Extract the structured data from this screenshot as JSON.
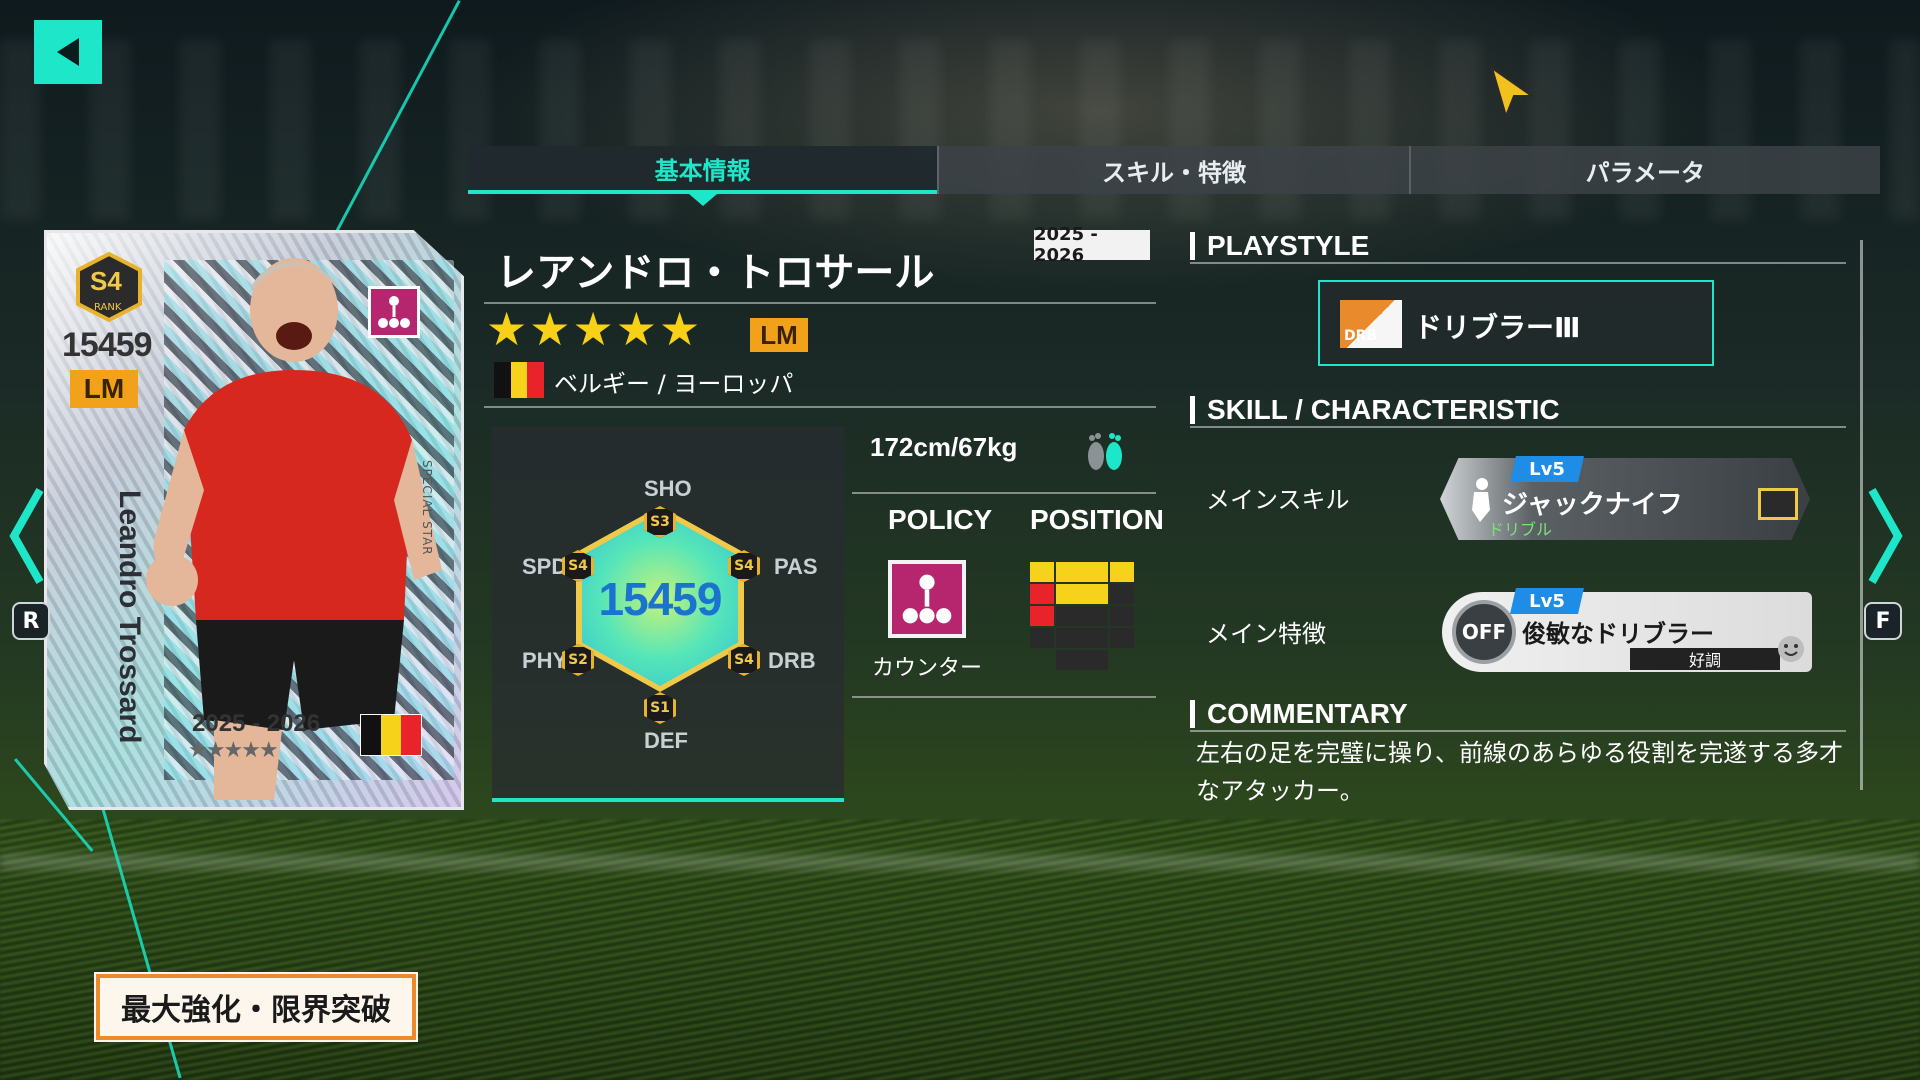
{
  "tabs": [
    {
      "label": "基本情報",
      "active": true
    },
    {
      "label": "スキル・特徴",
      "active": false
    },
    {
      "label": "パラメータ",
      "active": false
    }
  ],
  "card": {
    "rank": "S4",
    "rank_sub": "RANK",
    "rating": "15459",
    "position": "LM",
    "name": "Leandro Trossard",
    "tag": "SPECIAL STAR",
    "season": "2025 - 2026",
    "stars": "★★★★★"
  },
  "player": {
    "name": "レアンドロ・トロサール",
    "season": "2025 - 2026",
    "stars": "★★★★★",
    "position": "LM",
    "nation": "ベルギー / ヨーロッパ",
    "flag_colors": [
      "#111111",
      "#f6d21a",
      "#e8232a"
    ]
  },
  "stats": {
    "overall": "15459",
    "SHO": {
      "label": "SHO",
      "rank": "S3"
    },
    "PAS": {
      "label": "PAS",
      "rank": "S4"
    },
    "DRB": {
      "label": "DRB",
      "rank": "S4"
    },
    "DEF": {
      "label": "DEF",
      "rank": "S1"
    },
    "PHY": {
      "label": "PHY",
      "rank": "S2"
    },
    "SPD": {
      "label": "SPD",
      "rank": "S4"
    }
  },
  "body": "172cm/67kg",
  "policy": {
    "header": "POLICY",
    "value": "カウンター"
  },
  "position_header": "POSITION",
  "sections": {
    "playstyle": "PLAYSTYLE",
    "skill": "SKILL / CHARACTERISTIC",
    "commentary": "COMMENTARY"
  },
  "playstyle": {
    "tag": "DRB",
    "name": "ドリブラーⅢ"
  },
  "main_skill": {
    "label": "メインスキル",
    "level": "Lv5",
    "name": "ジャックナイフ",
    "tag": "ドリブル"
  },
  "main_trait": {
    "label": "メイン特徴",
    "level": "Lv5",
    "name": "俊敏なドリブラー",
    "state": "OFF",
    "condition": "好調"
  },
  "commentary_text": "左右の足を完璧に操り、前線のあらゆる役割を完遂する多才なアタッカー。",
  "enhance_button": "最大強化・限界突破",
  "nav": {
    "left_key": "R",
    "right_key": "F"
  },
  "colors": {
    "accent": "#1ee6c8",
    "position": "#f1a21a",
    "policy": "#b5266e"
  }
}
